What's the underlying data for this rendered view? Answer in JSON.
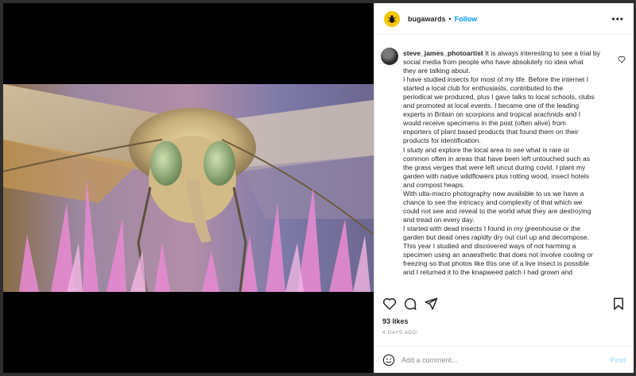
{
  "header": {
    "username": "bugawards",
    "separator": "•",
    "follow_label": "Follow",
    "more_label": "•••"
  },
  "comment": {
    "username": "steve_james_photoartist",
    "lines": [
      "It is always interesting to see a trial by",
      "social media from people who have absolutely no idea what",
      "they are talking about.",
      "I have studied insects for most of my life. Before the internet I",
      "started a local club for enthusiasts, contributed to the",
      "periodical we produced, plus I gave talks to local schools, clubs",
      "and promoted at local events. I became one of the leading",
      "experts in Britain on scorpions and tropical arachnids and I",
      "would receive specimens in the post (often alive) from",
      "importers of plant based products that found them on their",
      "products for identification.",
      "I study and explore the local area to see what is rare or",
      "common often in areas that have been left untouched such as",
      "the grass verges that were left uncut during covid. I plant my",
      "garden with native wildflowers plus rotting wood, insect hotels",
      "and compost heaps.",
      "With ulta-macro photography now available to us we have a",
      "chance to see the intricacy and complexity of that which we",
      "could not see and reveal to the world what they are destroying",
      "and tread on every day.",
      "I started with dead insects I found in my greenhouse or the",
      "garden but dead ones rapidly dry out curl up and decompose.",
      "This year I studied and discovered ways of not harming a",
      "specimen using an anaesthetic that does not involve cooling or",
      "freezing so that photos like this one of a live insect is possible",
      "and I returned it to the knapweed patch I had grown and"
    ]
  },
  "likes": "93 likes",
  "time": "4 DAYS AGO",
  "add_comment": {
    "placeholder": "Add a comment...",
    "post_label": "Post"
  },
  "colors": {
    "accent": "#0095f6",
    "post_disabled": "#b2dffc",
    "logo_bg": "#f7c600"
  },
  "icons": [
    "heart-icon",
    "comment-icon",
    "share-icon",
    "bookmark-icon",
    "emoji-icon",
    "bug-logo-icon"
  ]
}
